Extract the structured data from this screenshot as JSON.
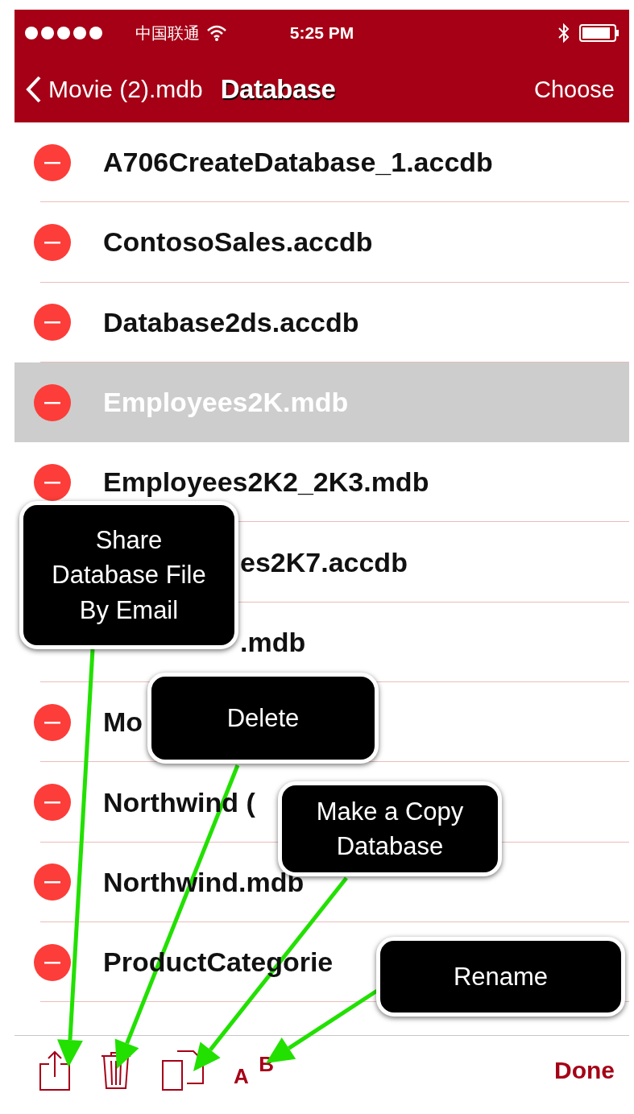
{
  "status_bar": {
    "carrier": "中国联通",
    "time": "5:25 PM"
  },
  "nav_bar": {
    "back": "Movie (2).mdb",
    "title": "Database",
    "action": "Choose"
  },
  "files": [
    {
      "name": "A706CreateDatabase_1.accdb",
      "selected": false,
      "kind": "plain"
    },
    {
      "name": "ContosoSales.accdb",
      "selected": false,
      "kind": "plain"
    },
    {
      "name": "Database2ds.accdb",
      "selected": false,
      "kind": "plain"
    },
    {
      "name": "Employees2K.mdb",
      "selected": true,
      "kind": "plain"
    },
    {
      "name": "Employees2K2_2K3.mdb",
      "selected": false,
      "kind": "plain"
    },
    {
      "name": "es2K7.accdb",
      "selected": false,
      "kind": "covered"
    },
    {
      "name": ".mdb",
      "selected": false,
      "kind": "covered"
    },
    {
      "name": "Mo",
      "selected": false,
      "kind": "plain"
    },
    {
      "name": "Northwind (",
      "selected": false,
      "kind": "plain"
    },
    {
      "name": "Northwind.mdb",
      "selected": false,
      "kind": "plain"
    },
    {
      "name": "ProductCategorie",
      "selected": false,
      "kind": "plain"
    }
  ],
  "callouts": [
    {
      "lines": [
        "Share",
        "Database File",
        "By Email"
      ]
    },
    {
      "lines": [
        "Delete"
      ]
    },
    {
      "lines": [
        "Make a Copy",
        "Database"
      ]
    },
    {
      "lines": [
        "Rename"
      ]
    }
  ],
  "toolbar": {
    "tools": [
      {
        "kind": "share"
      },
      {
        "kind": "trash"
      },
      {
        "kind": "copy"
      },
      {
        "kind": "rename",
        "letters": [
          "A",
          "B"
        ]
      }
    ],
    "done": "Done"
  }
}
